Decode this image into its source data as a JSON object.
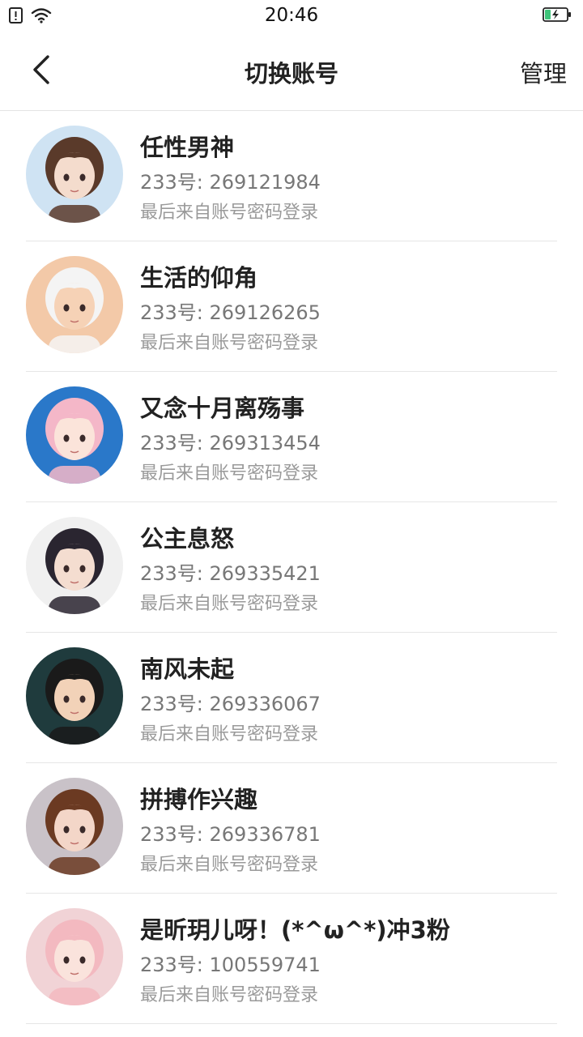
{
  "status_bar": {
    "time": "20:46",
    "icons": [
      "sim-alert-icon",
      "wifi-icon",
      "battery-charging-icon"
    ]
  },
  "nav": {
    "back_icon": "chevron-left-icon",
    "title": "切换账号",
    "manage_label": "管理"
  },
  "accounts": [
    {
      "name": "任性男神",
      "id_text": "233号: 269121984",
      "source": "最后来自账号密码登录",
      "avatar_bg": "#cfe3f3",
      "avatar_hair": "#5a3a2a",
      "avatar_skin": "#f4dccd"
    },
    {
      "name": "生活的仰角",
      "id_text": "233号: 269126265",
      "source": "最后来自账号密码登录",
      "avatar_bg": "#f3c9a8",
      "avatar_hair": "#f4f4f4",
      "avatar_skin": "#f6d2b6"
    },
    {
      "name": "又念十月离殇事",
      "id_text": "233号: 269313454",
      "source": "最后来自账号密码登录",
      "avatar_bg": "#2a78c9",
      "avatar_hair": "#f4b7c8",
      "avatar_skin": "#fbe4da"
    },
    {
      "name": "公主息怒",
      "id_text": "233号: 269335421",
      "source": "最后来自账号密码登录",
      "avatar_bg": "#f0f0f0",
      "avatar_hair": "#2a2530",
      "avatar_skin": "#f4ddd0"
    },
    {
      "name": "南风未起",
      "id_text": "233号: 269336067",
      "source": "最后来自账号密码登录",
      "avatar_bg": "#1f3b3d",
      "avatar_hair": "#1a1a1a",
      "avatar_skin": "#f2d2b8"
    },
    {
      "name": "拼搏作兴趣",
      "id_text": "233号: 269336781",
      "source": "最后来自账号密码登录",
      "avatar_bg": "#c9c2c8",
      "avatar_hair": "#6b3a22",
      "avatar_skin": "#f3d6c8"
    },
    {
      "name": "是昕玥儿呀！(*^ω^*)冲3粉",
      "id_text": "233号: 100559741",
      "source": "最后来自账号密码登录",
      "avatar_bg": "#f1d3d6",
      "avatar_hair": "#f3b9c0",
      "avatar_skin": "#fae3dc"
    }
  ],
  "colors": {
    "background": "#ffffff",
    "title_text": "#222222",
    "id_text": "#777777",
    "source_text": "#9a9a9a",
    "divider": "#e6e6e6",
    "battery_fill": "#3ec47a"
  }
}
